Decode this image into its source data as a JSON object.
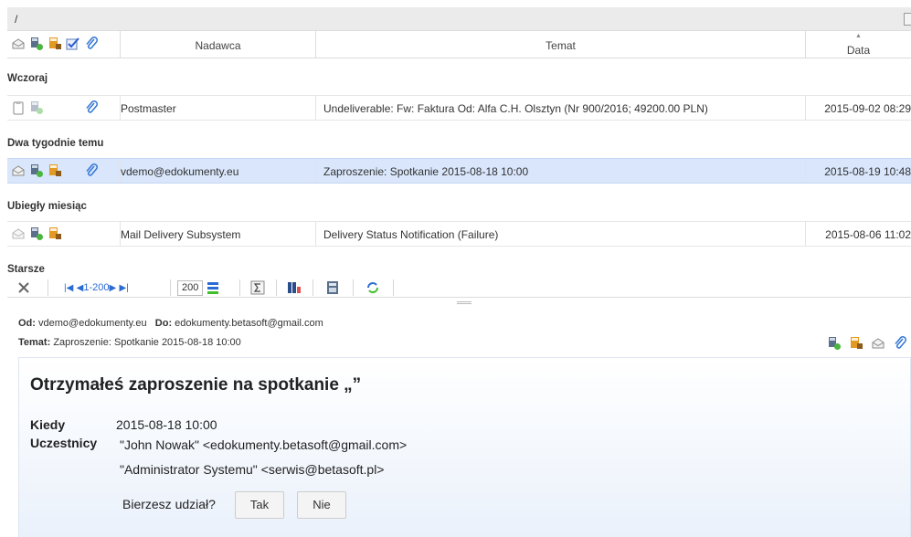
{
  "path": "/",
  "columns": {
    "sender": "Nadawca",
    "subject": "Temat",
    "date": "Data"
  },
  "groups": [
    {
      "label": "Wczoraj"
    },
    {
      "label": "Dwa tygodnie temu"
    },
    {
      "label": "Ubiegły miesiąc"
    },
    {
      "label": "Starsze"
    }
  ],
  "messages": [
    {
      "sender": "Postmaster",
      "subject": "Undeliverable: Fw: Faktura Od: Alfa C.H. Olsztyn (Nr 900/2016; 49200.00 PLN)",
      "date": "2015-09-02 08:29",
      "status_color": "#f19a0b"
    },
    {
      "sender": "vdemo@edokumenty.eu",
      "subject": "Zaproszenie: Spotkanie 2015-08-18 10:00",
      "date": "2015-08-19 10:48",
      "status_color": "#3fbf2a"
    },
    {
      "sender": "Mail Delivery Subsystem",
      "subject": "Delivery Status Notification (Failure)",
      "date": "2015-08-06 11:02",
      "status_color": "#9a9a9a"
    }
  ],
  "pager": {
    "range": "1-200",
    "page_size": "200"
  },
  "preview": {
    "from_label": "Od:",
    "from_value": "vdemo@edokumenty.eu",
    "to_label": "Do:",
    "to_value": "edokumenty.betasoft@gmail.com",
    "subject_label": "Temat:",
    "subject_value": "Zaproszenie: Spotkanie 2015-08-18 10:00"
  },
  "invitation": {
    "title": "Otrzymałeś zaproszenie na spotkanie „”",
    "when_label": "Kiedy",
    "when_value": "2015-08-18 10:00",
    "attendees_label": "Uczestnicy",
    "attendees": [
      "\"John Nowak\" <edokumenty.betasoft@gmail.com>",
      "\"Administrator Systemu\" <serwis@betasoft.pl>"
    ],
    "question": "Bierzesz udział?",
    "accept_label": "Tak",
    "decline_label": "Nie"
  },
  "colors": {
    "selected_row": "#d9e6fb",
    "link_blue": "#2a6bd3"
  }
}
